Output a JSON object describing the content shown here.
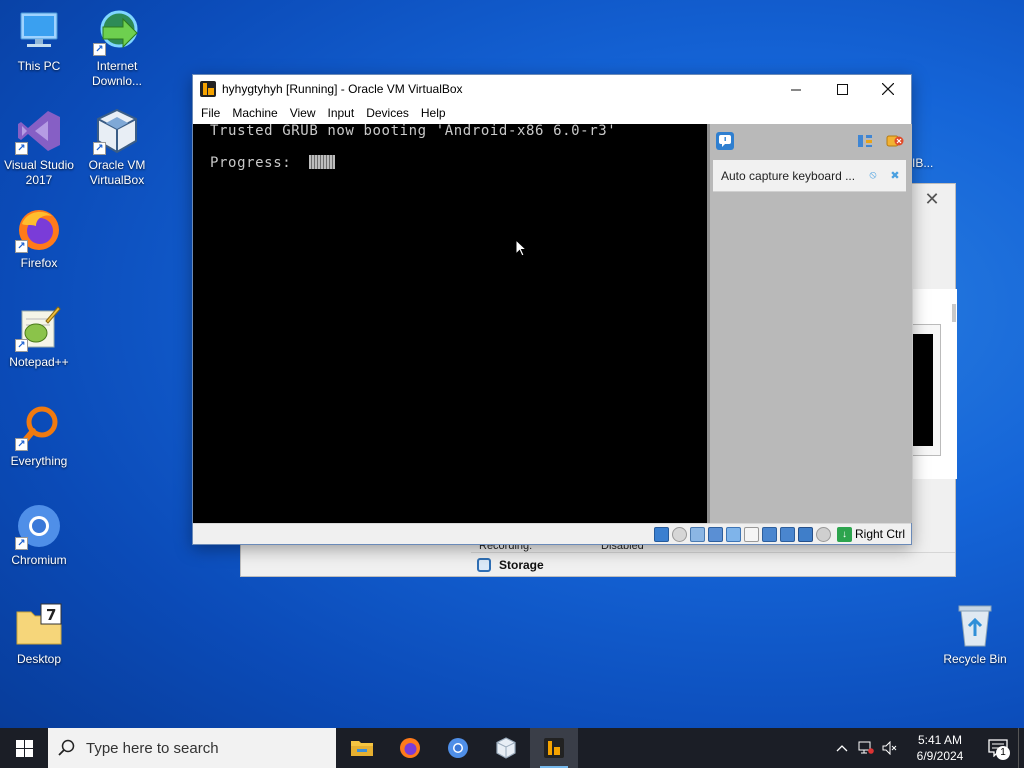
{
  "desktop": {
    "icons": [
      {
        "label": "This PC",
        "icon": "computer-icon"
      },
      {
        "label": "Internet Downlo...",
        "icon": "download-manager-icon"
      },
      {
        "label": "Visual Studio 2017",
        "icon": "visual-studio-icon"
      },
      {
        "label": "Oracle VM VirtualBox",
        "icon": "virtualbox-icon"
      },
      {
        "label": "Firefox",
        "icon": "firefox-icon"
      },
      {
        "label": "Notepad++",
        "icon": "notepad-plus-plus-icon"
      },
      {
        "label": "Everything",
        "icon": "search-everything-icon"
      },
      {
        "label": "Chromium",
        "icon": "chromium-icon"
      },
      {
        "label": "Desktop",
        "icon": "folder-icon"
      },
      {
        "label": "Recycle Bin",
        "icon": "recycle-bin-icon"
      }
    ],
    "behind_label": "IB..."
  },
  "background_window": {
    "recording_label": "Recording:",
    "recording_value": "Disabled",
    "storage_label": "Storage"
  },
  "vm_window": {
    "title": "hyhygtyhyh [Running] - Oracle VM VirtualBox",
    "menu": [
      "File",
      "Machine",
      "View",
      "Input",
      "Devices",
      "Help"
    ],
    "screen": {
      "line1": "Trusted GRUB now booting 'Android-x86 6.0-r3'",
      "progress_label": "Progress:"
    },
    "notification": "Auto capture keyboard ...",
    "host_key": "Right Ctrl"
  },
  "taskbar": {
    "search_placeholder": "Type here to search",
    "time": "5:41 AM",
    "date": "6/9/2024",
    "notification_count": "1"
  },
  "colors": {
    "desktop_bg": "#1565d8",
    "taskbar_bg": "#1b1e26",
    "vm_screen_bg": "#000000",
    "side_panel_bg": "#b9b9b9"
  }
}
